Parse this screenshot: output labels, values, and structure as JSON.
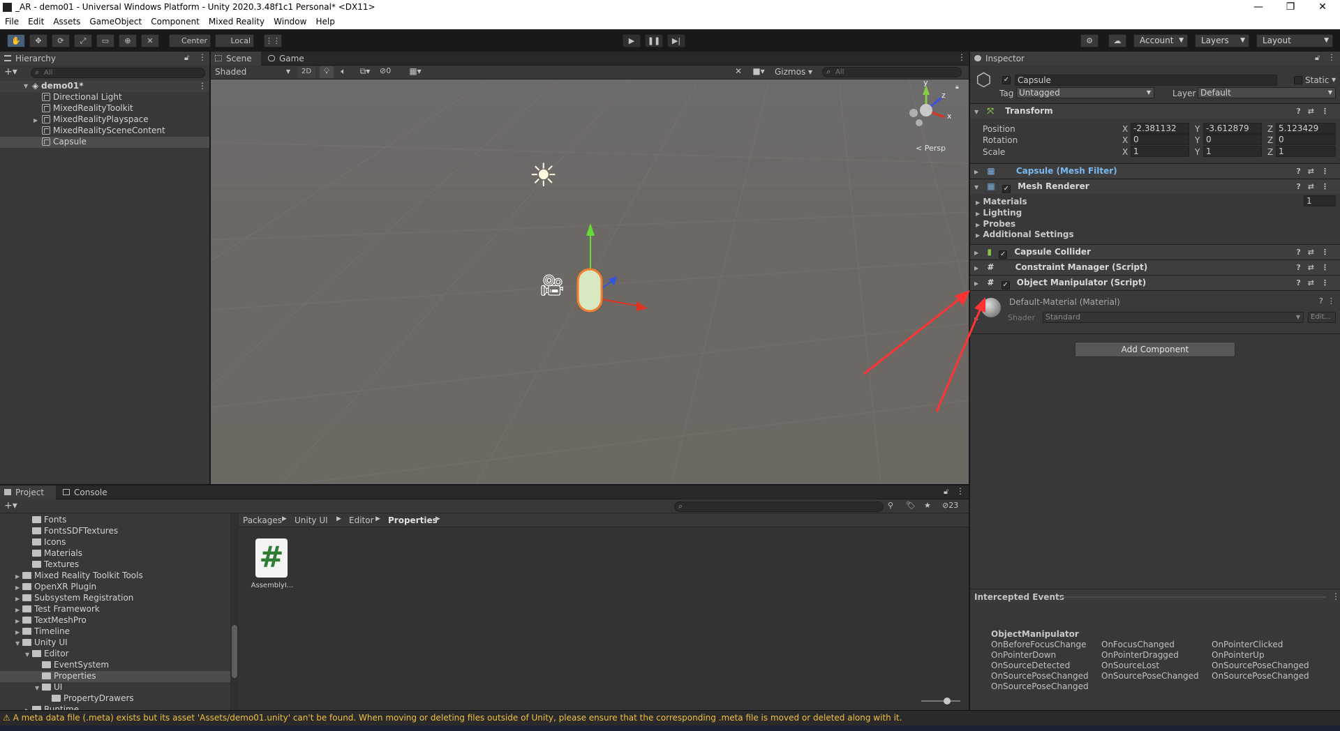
{
  "window": {
    "title": "_AR - demo01 - Universal Windows Platform - Unity 2020.3.48f1c1 Personal* <DX11>",
    "minimize": "—",
    "maximize": "❐",
    "close": "✕"
  },
  "menu": [
    "File",
    "Edit",
    "Assets",
    "GameObject",
    "Component",
    "Mixed Reality",
    "Window",
    "Help"
  ],
  "toolbar": {
    "center_label": "Center",
    "local_label": "Local",
    "account_label": "Account",
    "layers_label": "Layers",
    "layout_label": "Layout"
  },
  "hierarchy": {
    "tab": "Hierarchy",
    "search_placeholder": "All",
    "scene_name": "demo01*",
    "items": [
      "Directional Light",
      "MixedRealityToolkit",
      "MixedRealityPlayspace",
      "MixedRealitySceneContent",
      "Capsule"
    ]
  },
  "scene": {
    "tab_scene": "Scene",
    "tab_game": "Game",
    "shading": "Shaded",
    "mode_2d": "2D",
    "hidden_count": "0",
    "gizmos": "Gizmos",
    "search_placeholder": "All",
    "persp": "< Persp",
    "axis_y": "y",
    "axis_z": "z",
    "axis_x": "x"
  },
  "project": {
    "tab_project": "Project",
    "tab_console": "Console",
    "hidden_count": "23",
    "tree": [
      {
        "label": "Fonts",
        "indent": 2,
        "fold": ""
      },
      {
        "label": "FontsSDFTextures",
        "indent": 2,
        "fold": ""
      },
      {
        "label": "Icons",
        "indent": 2,
        "fold": ""
      },
      {
        "label": "Materials",
        "indent": 2,
        "fold": ""
      },
      {
        "label": "Textures",
        "indent": 2,
        "fold": ""
      },
      {
        "label": "Mixed Reality Toolkit Tools",
        "indent": 1,
        "fold": "▶"
      },
      {
        "label": "OpenXR Plugin",
        "indent": 1,
        "fold": "▶"
      },
      {
        "label": "Subsystem Registration",
        "indent": 1,
        "fold": "▶"
      },
      {
        "label": "Test Framework",
        "indent": 1,
        "fold": "▶"
      },
      {
        "label": "TextMeshPro",
        "indent": 1,
        "fold": "▶"
      },
      {
        "label": "Timeline",
        "indent": 1,
        "fold": "▶"
      },
      {
        "label": "Unity UI",
        "indent": 1,
        "fold": "▼"
      },
      {
        "label": "Editor",
        "indent": 2,
        "fold": "▼"
      },
      {
        "label": "EventSystem",
        "indent": 3,
        "fold": ""
      },
      {
        "label": "Properties",
        "indent": 3,
        "fold": ""
      },
      {
        "label": "UI",
        "indent": 3,
        "fold": "▼"
      },
      {
        "label": "PropertyDrawers",
        "indent": 4,
        "fold": ""
      },
      {
        "label": "Runtime",
        "indent": 2,
        "fold": "▶"
      }
    ],
    "breadcrumb": [
      "Packages",
      "Unity UI",
      "Editor",
      "Properties"
    ],
    "asset_name": "AssemblyI...",
    "asset_glyph": "#"
  },
  "inspector": {
    "tab": "Inspector",
    "object_name": "Capsule",
    "static_label": "Static",
    "tag_label": "Tag",
    "tag_value": "Untagged",
    "layer_label": "Layer",
    "layer_value": "Default",
    "transform": {
      "title": "Transform",
      "position_label": "Position",
      "rotation_label": "Rotation",
      "scale_label": "Scale",
      "position": [
        "-2.381132",
        "-3.612879",
        "5.123429"
      ],
      "rotation": [
        "0",
        "0",
        "0"
      ],
      "scale": [
        "1",
        "1",
        "1"
      ],
      "axis_x": "X",
      "axis_y": "Y",
      "axis_z": "Z"
    },
    "mesh_filter": "Capsule (Mesh Filter)",
    "mesh_renderer": "Mesh Renderer",
    "mesh_sections": [
      "Materials",
      "Lighting",
      "Probes",
      "Additional Settings"
    ],
    "materials_count": "1",
    "capsule_collider": "Capsule Collider",
    "constraint_manager": "Constraint Manager (Script)",
    "object_manipulator": "Object Manipulator (Script)",
    "material_name": "Default-Material (Material)",
    "shader_label": "Shader",
    "shader_value": "Standard",
    "edit_label": "Edit...",
    "add_component": "Add Component",
    "intercepted_title": "Intercepted Events",
    "events_group": "ObjectManipulator",
    "events": [
      [
        "OnBeforeFocusChange",
        "OnFocusChanged",
        "OnPointerClicked"
      ],
      [
        "OnPointerDown",
        "OnPointerDragged",
        "OnPointerUp"
      ],
      [
        "OnSourceDetected",
        "OnSourceLost",
        "OnSourcePoseChanged"
      ],
      [
        "OnSourcePoseChanged",
        "OnSourcePoseChanged",
        "OnSourcePoseChanged"
      ],
      [
        "OnSourcePoseChanged",
        "",
        ""
      ]
    ]
  },
  "status": {
    "message": "A meta data file (.meta) exists but its asset 'Assets/demo01.unity' can't be found. When moving or deleting files outside of Unity, please ensure that the corresponding .meta file is moved or deleted along with it."
  },
  "colors": {
    "accent_blue": "#46607c",
    "warning": "#f0c040",
    "arrow_red": "#ff3333"
  }
}
